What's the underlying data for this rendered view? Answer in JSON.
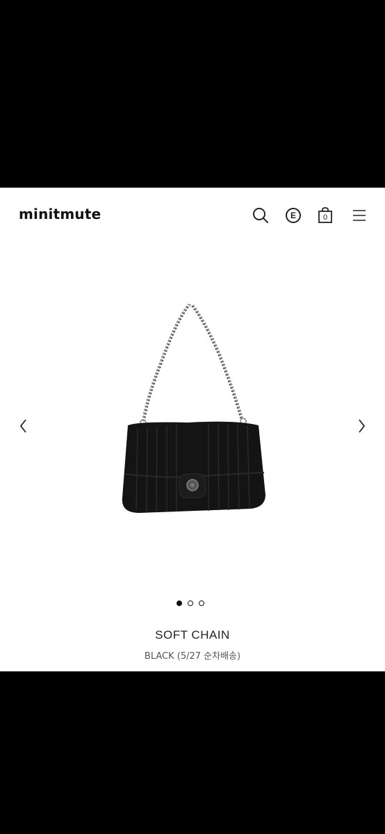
{
  "brand": {
    "logo_text": "minitmute"
  },
  "header": {
    "icons": [
      "search-icon",
      "e-badge-icon",
      "shopping-bag-icon",
      "menu-icon"
    ],
    "e_badge_label": "E",
    "cart_count": "0"
  },
  "carousel": {
    "image_alt": "black quilted shoulder bag with chain strap",
    "prev_icon": "chevron-left-icon",
    "next_icon": "chevron-right-icon",
    "active_slide": 1,
    "slide_count": 3
  },
  "product": {
    "name": "SOFT CHAIN",
    "option": "BLACK (5/27 순차배송)"
  },
  "colors": {
    "background": "#ffffff",
    "text": "#222222",
    "bag": "#141414"
  }
}
